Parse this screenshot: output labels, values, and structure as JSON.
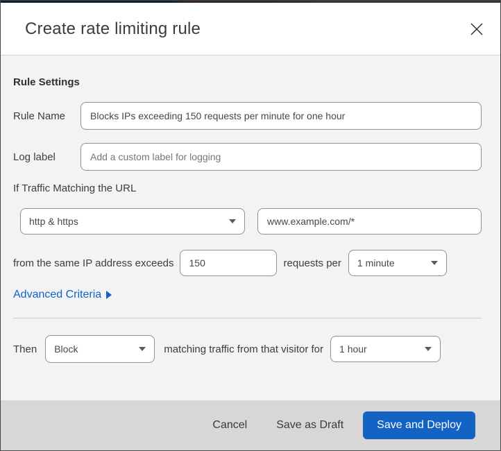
{
  "modal": {
    "title": "Create rate limiting rule"
  },
  "section": {
    "heading": "Rule Settings"
  },
  "fields": {
    "rule_name": {
      "label": "Rule Name",
      "value": "Blocks IPs exceeding 150 requests per minute for one hour"
    },
    "log_label": {
      "label": "Log label",
      "placeholder": "Add a custom label for logging"
    }
  },
  "traffic": {
    "intro": "If Traffic Matching the URL",
    "scheme_selected": "http & https",
    "url_value": "www.example.com/*",
    "threshold_prefix": "from the same IP address exceeds",
    "threshold_value": "150",
    "threshold_suffix": "requests per",
    "period_selected": "1 minute",
    "advanced_link": "Advanced Criteria"
  },
  "action": {
    "then_label": "Then",
    "action_selected": "Block",
    "middle_text": "matching traffic from that visitor for",
    "duration_selected": "1 hour"
  },
  "footer": {
    "cancel": "Cancel",
    "save_draft": "Save as Draft",
    "save_deploy": "Save and Deploy"
  },
  "colors": {
    "primary_blue": "#1363c5",
    "link_blue": "#0d63cc",
    "body_bg": "#f4f3f3",
    "footer_bg": "#d9d6d6",
    "input_border": "#919191"
  }
}
